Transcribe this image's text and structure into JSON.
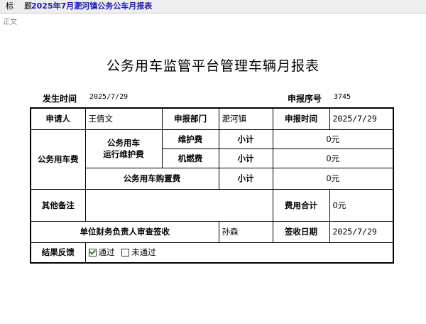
{
  "titlebar": {
    "label": "标　题",
    "separator": ":",
    "value": "2025年7月淝河镇公务公车月报表"
  },
  "body_label": "正文",
  "doc": {
    "heading": "公务用车监管平台管理车辆月报表",
    "time_label": "发生时间",
    "time_value": "2025/7/29",
    "serial_label": "申报序号",
    "serial_value": "3745"
  },
  "form": {
    "applicant_label": "申请人",
    "applicant_value": "王倩文",
    "dept_label": "申报部门",
    "dept_value": "淝河镇",
    "apply_time_label": "申报时间",
    "apply_time_value": "2025/7/29",
    "fee_group_label": "公务用车费",
    "ops_group_label_1": "公务用车",
    "ops_group_label_2": "运行维护费",
    "maint_label": "维护费",
    "fuel_label": "机燃费",
    "purchase_label": "公务用车购置费",
    "subtotal_label": "小计",
    "maint_value": "0元",
    "fuel_value": "0元",
    "purchase_value": "0元",
    "remarks_label": "其他备注",
    "remarks_value": "",
    "total_label": "费用合计",
    "total_value": "0元",
    "sign_label": "单位财务负责人审查签收",
    "sign_value": "孙森",
    "receive_date_label": "签收日期",
    "receive_date_value": "2025/7/29",
    "result_label": "结果反馈",
    "opt_pass": "通过",
    "opt_fail": "未通过"
  }
}
